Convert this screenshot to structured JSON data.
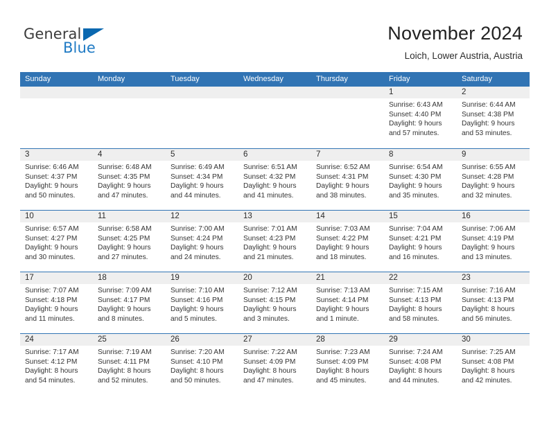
{
  "brand": {
    "name_top": "General",
    "name_bottom": "Blue",
    "accent_color": "#1f7ac4",
    "triangle_color": "#0b68b0"
  },
  "header": {
    "title": "November 2024",
    "subtitle": "Loich, Lower Austria, Austria"
  },
  "theme": {
    "header_blue": "#3174b4",
    "day_band_gray": "#efefef",
    "text_color": "#333333"
  },
  "weekdays": [
    "Sunday",
    "Monday",
    "Tuesday",
    "Wednesday",
    "Thursday",
    "Friday",
    "Saturday"
  ],
  "weeks": [
    [
      {
        "day": "",
        "empty": true,
        "sunrise": "",
        "sunset": "",
        "daylight_line1": "",
        "daylight_line2": ""
      },
      {
        "day": "",
        "empty": true,
        "sunrise": "",
        "sunset": "",
        "daylight_line1": "",
        "daylight_line2": ""
      },
      {
        "day": "",
        "empty": true,
        "sunrise": "",
        "sunset": "",
        "daylight_line1": "",
        "daylight_line2": ""
      },
      {
        "day": "",
        "empty": true,
        "sunrise": "",
        "sunset": "",
        "daylight_line1": "",
        "daylight_line2": ""
      },
      {
        "day": "",
        "empty": true,
        "sunrise": "",
        "sunset": "",
        "daylight_line1": "",
        "daylight_line2": ""
      },
      {
        "day": "1",
        "empty": false,
        "sunrise": "Sunrise: 6:43 AM",
        "sunset": "Sunset: 4:40 PM",
        "daylight_line1": "Daylight: 9 hours",
        "daylight_line2": "and 57 minutes."
      },
      {
        "day": "2",
        "empty": false,
        "sunrise": "Sunrise: 6:44 AM",
        "sunset": "Sunset: 4:38 PM",
        "daylight_line1": "Daylight: 9 hours",
        "daylight_line2": "and 53 minutes."
      }
    ],
    [
      {
        "day": "3",
        "empty": false,
        "sunrise": "Sunrise: 6:46 AM",
        "sunset": "Sunset: 4:37 PM",
        "daylight_line1": "Daylight: 9 hours",
        "daylight_line2": "and 50 minutes."
      },
      {
        "day": "4",
        "empty": false,
        "sunrise": "Sunrise: 6:48 AM",
        "sunset": "Sunset: 4:35 PM",
        "daylight_line1": "Daylight: 9 hours",
        "daylight_line2": "and 47 minutes."
      },
      {
        "day": "5",
        "empty": false,
        "sunrise": "Sunrise: 6:49 AM",
        "sunset": "Sunset: 4:34 PM",
        "daylight_line1": "Daylight: 9 hours",
        "daylight_line2": "and 44 minutes."
      },
      {
        "day": "6",
        "empty": false,
        "sunrise": "Sunrise: 6:51 AM",
        "sunset": "Sunset: 4:32 PM",
        "daylight_line1": "Daylight: 9 hours",
        "daylight_line2": "and 41 minutes."
      },
      {
        "day": "7",
        "empty": false,
        "sunrise": "Sunrise: 6:52 AM",
        "sunset": "Sunset: 4:31 PM",
        "daylight_line1": "Daylight: 9 hours",
        "daylight_line2": "and 38 minutes."
      },
      {
        "day": "8",
        "empty": false,
        "sunrise": "Sunrise: 6:54 AM",
        "sunset": "Sunset: 4:30 PM",
        "daylight_line1": "Daylight: 9 hours",
        "daylight_line2": "and 35 minutes."
      },
      {
        "day": "9",
        "empty": false,
        "sunrise": "Sunrise: 6:55 AM",
        "sunset": "Sunset: 4:28 PM",
        "daylight_line1": "Daylight: 9 hours",
        "daylight_line2": "and 32 minutes."
      }
    ],
    [
      {
        "day": "10",
        "empty": false,
        "sunrise": "Sunrise: 6:57 AM",
        "sunset": "Sunset: 4:27 PM",
        "daylight_line1": "Daylight: 9 hours",
        "daylight_line2": "and 30 minutes."
      },
      {
        "day": "11",
        "empty": false,
        "sunrise": "Sunrise: 6:58 AM",
        "sunset": "Sunset: 4:25 PM",
        "daylight_line1": "Daylight: 9 hours",
        "daylight_line2": "and 27 minutes."
      },
      {
        "day": "12",
        "empty": false,
        "sunrise": "Sunrise: 7:00 AM",
        "sunset": "Sunset: 4:24 PM",
        "daylight_line1": "Daylight: 9 hours",
        "daylight_line2": "and 24 minutes."
      },
      {
        "day": "13",
        "empty": false,
        "sunrise": "Sunrise: 7:01 AM",
        "sunset": "Sunset: 4:23 PM",
        "daylight_line1": "Daylight: 9 hours",
        "daylight_line2": "and 21 minutes."
      },
      {
        "day": "14",
        "empty": false,
        "sunrise": "Sunrise: 7:03 AM",
        "sunset": "Sunset: 4:22 PM",
        "daylight_line1": "Daylight: 9 hours",
        "daylight_line2": "and 18 minutes."
      },
      {
        "day": "15",
        "empty": false,
        "sunrise": "Sunrise: 7:04 AM",
        "sunset": "Sunset: 4:21 PM",
        "daylight_line1": "Daylight: 9 hours",
        "daylight_line2": "and 16 minutes."
      },
      {
        "day": "16",
        "empty": false,
        "sunrise": "Sunrise: 7:06 AM",
        "sunset": "Sunset: 4:19 PM",
        "daylight_line1": "Daylight: 9 hours",
        "daylight_line2": "and 13 minutes."
      }
    ],
    [
      {
        "day": "17",
        "empty": false,
        "sunrise": "Sunrise: 7:07 AM",
        "sunset": "Sunset: 4:18 PM",
        "daylight_line1": "Daylight: 9 hours",
        "daylight_line2": "and 11 minutes."
      },
      {
        "day": "18",
        "empty": false,
        "sunrise": "Sunrise: 7:09 AM",
        "sunset": "Sunset: 4:17 PM",
        "daylight_line1": "Daylight: 9 hours",
        "daylight_line2": "and 8 minutes."
      },
      {
        "day": "19",
        "empty": false,
        "sunrise": "Sunrise: 7:10 AM",
        "sunset": "Sunset: 4:16 PM",
        "daylight_line1": "Daylight: 9 hours",
        "daylight_line2": "and 5 minutes."
      },
      {
        "day": "20",
        "empty": false,
        "sunrise": "Sunrise: 7:12 AM",
        "sunset": "Sunset: 4:15 PM",
        "daylight_line1": "Daylight: 9 hours",
        "daylight_line2": "and 3 minutes."
      },
      {
        "day": "21",
        "empty": false,
        "sunrise": "Sunrise: 7:13 AM",
        "sunset": "Sunset: 4:14 PM",
        "daylight_line1": "Daylight: 9 hours",
        "daylight_line2": "and 1 minute."
      },
      {
        "day": "22",
        "empty": false,
        "sunrise": "Sunrise: 7:15 AM",
        "sunset": "Sunset: 4:13 PM",
        "daylight_line1": "Daylight: 8 hours",
        "daylight_line2": "and 58 minutes."
      },
      {
        "day": "23",
        "empty": false,
        "sunrise": "Sunrise: 7:16 AM",
        "sunset": "Sunset: 4:13 PM",
        "daylight_line1": "Daylight: 8 hours",
        "daylight_line2": "and 56 minutes."
      }
    ],
    [
      {
        "day": "24",
        "empty": false,
        "sunrise": "Sunrise: 7:17 AM",
        "sunset": "Sunset: 4:12 PM",
        "daylight_line1": "Daylight: 8 hours",
        "daylight_line2": "and 54 minutes."
      },
      {
        "day": "25",
        "empty": false,
        "sunrise": "Sunrise: 7:19 AM",
        "sunset": "Sunset: 4:11 PM",
        "daylight_line1": "Daylight: 8 hours",
        "daylight_line2": "and 52 minutes."
      },
      {
        "day": "26",
        "empty": false,
        "sunrise": "Sunrise: 7:20 AM",
        "sunset": "Sunset: 4:10 PM",
        "daylight_line1": "Daylight: 8 hours",
        "daylight_line2": "and 50 minutes."
      },
      {
        "day": "27",
        "empty": false,
        "sunrise": "Sunrise: 7:22 AM",
        "sunset": "Sunset: 4:09 PM",
        "daylight_line1": "Daylight: 8 hours",
        "daylight_line2": "and 47 minutes."
      },
      {
        "day": "28",
        "empty": false,
        "sunrise": "Sunrise: 7:23 AM",
        "sunset": "Sunset: 4:09 PM",
        "daylight_line1": "Daylight: 8 hours",
        "daylight_line2": "and 45 minutes."
      },
      {
        "day": "29",
        "empty": false,
        "sunrise": "Sunrise: 7:24 AM",
        "sunset": "Sunset: 4:08 PM",
        "daylight_line1": "Daylight: 8 hours",
        "daylight_line2": "and 44 minutes."
      },
      {
        "day": "30",
        "empty": false,
        "sunrise": "Sunrise: 7:25 AM",
        "sunset": "Sunset: 4:08 PM",
        "daylight_line1": "Daylight: 8 hours",
        "daylight_line2": "and 42 minutes."
      }
    ]
  ]
}
